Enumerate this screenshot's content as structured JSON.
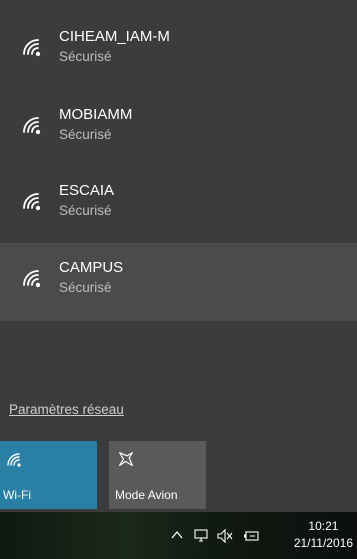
{
  "networks": [
    {
      "name": "CIHEAM_IAM-M",
      "status": "Sécurisé",
      "selected": false
    },
    {
      "name": "MOBIAMM",
      "status": "Sécurisé",
      "selected": false
    },
    {
      "name": "ESCAIA",
      "status": "Sécurisé",
      "selected": false
    },
    {
      "name": "CAMPUS",
      "status": "Sécurisé",
      "selected": true
    }
  ],
  "settings_link": "Paramètres réseau",
  "quick_actions": [
    {
      "label": "Wi-Fi",
      "icon": "wifi-icon",
      "active": true,
      "color": "#2a7fa4"
    },
    {
      "label": "Mode Avion",
      "icon": "airplane-icon",
      "active": false,
      "color": "#5a5a5a"
    }
  ],
  "taskbar": {
    "icons": [
      "chevron-up-icon",
      "network-icon",
      "volume-muted-icon",
      "battery-icon"
    ],
    "time": "10:21",
    "date": "21/11/2016"
  }
}
